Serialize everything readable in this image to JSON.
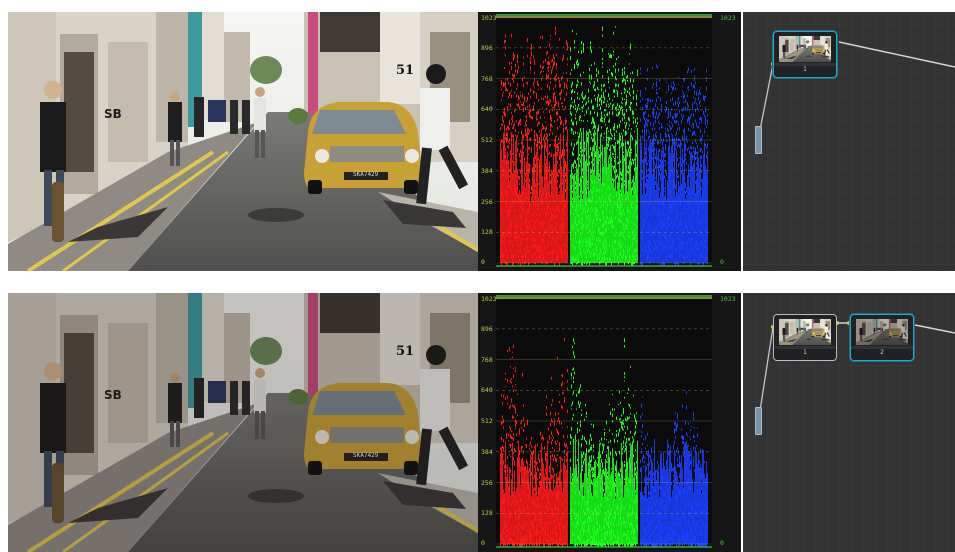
{
  "viewer": {
    "shopfront_number": "51",
    "graffiti_text": "SB",
    "plate_text": "SKA7429"
  },
  "scope": {
    "tick_labels": [
      "1023",
      "896",
      "768",
      "640",
      "512",
      "384",
      "256",
      "128",
      "0"
    ],
    "right_top_label": "1023",
    "right_bottom_label": "0"
  },
  "panels": [
    {
      "id": "original",
      "nodes": [
        {
          "label": "1",
          "selected": true
        }
      ]
    },
    {
      "id": "graded",
      "nodes": [
        {
          "label": "1",
          "selected": false
        },
        {
          "label": "2",
          "selected": true
        }
      ]
    }
  ],
  "colors": {
    "red_channel": "#ff1a1a",
    "green_channel": "#1aff1a",
    "blue_channel": "#1a40ff",
    "scope_graticule": "#c6c64a",
    "node_selected": "#28a7c9"
  }
}
